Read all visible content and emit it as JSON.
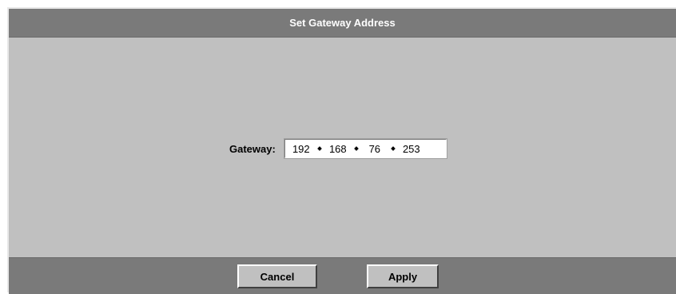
{
  "dialog": {
    "title": "Set Gateway Address"
  },
  "gateway": {
    "label": "Gateway:",
    "octets": [
      "192",
      "168",
      "76",
      "253"
    ]
  },
  "buttons": {
    "cancel_label": "Cancel",
    "apply_label": "Apply"
  }
}
